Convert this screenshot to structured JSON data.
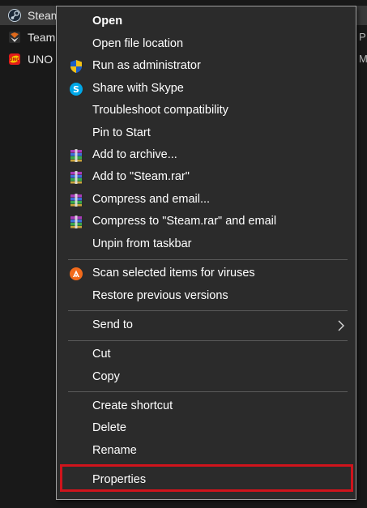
{
  "desktop": {
    "files": [
      {
        "name": "Steam",
        "icon": "steam-icon",
        "edge": ""
      },
      {
        "name": "Team",
        "icon": "team-icon",
        "edge": "P"
      },
      {
        "name": "UNO",
        "icon": "uno-icon",
        "edge": "M"
      }
    ]
  },
  "menu": {
    "open": "Open",
    "open_file_location": "Open file location",
    "run_as_admin": "Run as administrator",
    "share_skype": "Share with Skype",
    "troubleshoot": "Troubleshoot compatibility",
    "pin_start": "Pin to Start",
    "add_archive": "Add to archive...",
    "add_steam_rar": "Add to \"Steam.rar\"",
    "compress_email": "Compress and email...",
    "compress_steam_email": "Compress to \"Steam.rar\" and email",
    "unpin_taskbar": "Unpin from taskbar",
    "scan_viruses": "Scan selected items for viruses",
    "restore_versions": "Restore previous versions",
    "send_to": "Send to",
    "cut": "Cut",
    "copy": "Copy",
    "create_shortcut": "Create shortcut",
    "delete": "Delete",
    "rename": "Rename",
    "properties": "Properties"
  },
  "colors": {
    "menu_bg": "#2b2b2b",
    "highlight": "#d0141c",
    "text": "#ffffff"
  }
}
